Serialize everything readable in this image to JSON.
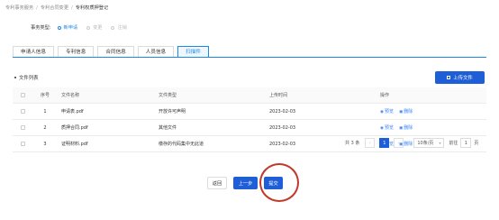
{
  "breadcrumb": {
    "items": [
      "专利事务服务",
      "专利合同变更",
      "专利权质押登记"
    ],
    "separator": "/"
  },
  "biz_type": {
    "label": "事务类型:",
    "options": [
      {
        "label": "新申请",
        "checked": true
      },
      {
        "label": "变更",
        "checked": false
      },
      {
        "label": "注销",
        "checked": false
      }
    ]
  },
  "tabs": [
    {
      "label": "申请人信息"
    },
    {
      "label": "专利信息"
    },
    {
      "label": "合同信息"
    },
    {
      "label": "人员信息"
    },
    {
      "label": "扫描件",
      "active": true
    }
  ],
  "file_list": {
    "title": "文件列表",
    "upload_label": "上传文件"
  },
  "table": {
    "headers": {
      "index": "序号",
      "name": "文件名称",
      "type": "文件类型",
      "time": "上传时间",
      "action": "操作"
    },
    "rows": [
      {
        "index": "1",
        "name": "申请表.pdf",
        "type": "开放许可声明",
        "time": "2023-02-03",
        "preview": "预览",
        "delete": "删除"
      },
      {
        "index": "2",
        "name": "质押合同.pdf",
        "type": "其他文件",
        "time": "2023-02-03",
        "preview": "预览",
        "delete": "删除"
      },
      {
        "index": "3",
        "name": "证明材料.pdf",
        "type": "缴存的代码集中无此道",
        "time": "2023-02-03",
        "preview": "预览",
        "delete": "删除"
      }
    ]
  },
  "pagination": {
    "total_text": "共 3 条",
    "current_page": "1",
    "page_size": "10条/页",
    "goto_label": "前往",
    "goto_value": "1",
    "page_unit": "页"
  },
  "actions": {
    "back_label": "返回",
    "prev_label": "上一步",
    "submit_label": "提交"
  },
  "colors": {
    "primary": "#1e5fd8",
    "link": "#3b82f6",
    "highlight": "#c0392b"
  }
}
